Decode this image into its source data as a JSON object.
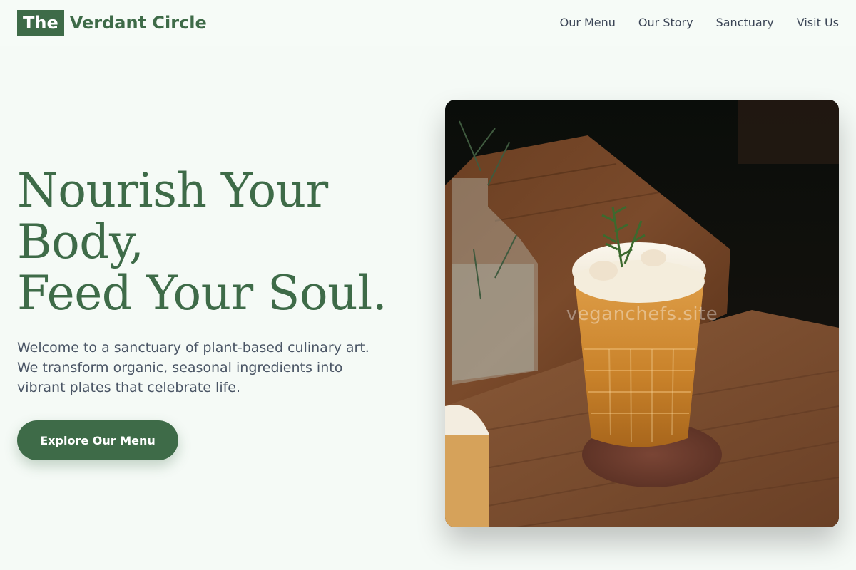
{
  "header": {
    "logo_mark": "The",
    "logo_text": "Verdant Circle",
    "nav": [
      "Our Menu",
      "Our Story",
      "Sanctuary",
      "Visit Us"
    ]
  },
  "hero": {
    "title_lines": [
      "Nourish Your",
      "Body,",
      "Feed Your Soul."
    ],
    "description": "Welcome to a sanctuary of plant-based culinary art. We transform organic, seasonal ingredients into vibrant plates that celebrate life.",
    "cta_label": "Explore Our Menu",
    "image": {
      "subject": "iced-amber-drink-with-rosemary",
      "watermark": "veganchefs.site"
    }
  },
  "colors": {
    "accent": "#3e6b48",
    "background": "#f5faf6",
    "nav_text": "#3b4556",
    "body_text": "#4a5565"
  }
}
